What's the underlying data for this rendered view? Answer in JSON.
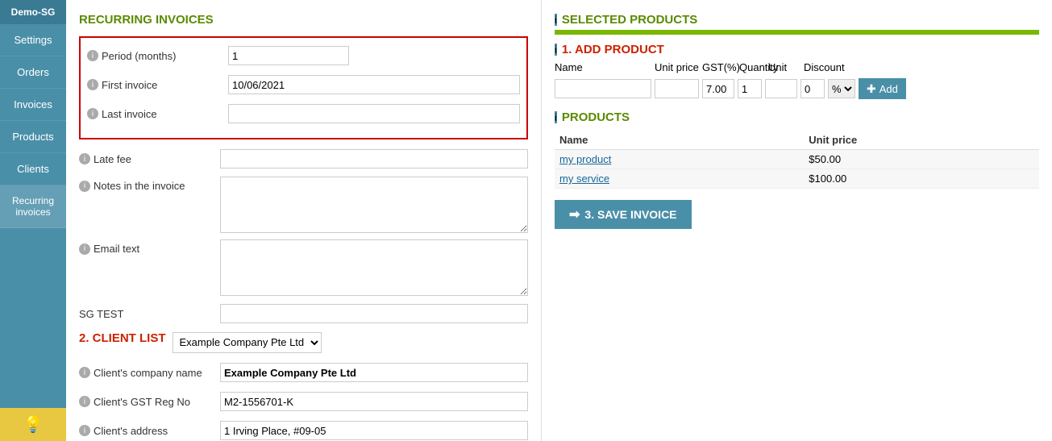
{
  "sidebar": {
    "demo_label": "Demo-SG",
    "items": [
      {
        "id": "settings",
        "label": "Settings"
      },
      {
        "id": "orders",
        "label": "Orders"
      },
      {
        "id": "invoices",
        "label": "Invoices"
      },
      {
        "id": "products",
        "label": "Products"
      },
      {
        "id": "clients",
        "label": "Clients"
      },
      {
        "id": "recurring",
        "label": "Recurring invoices",
        "active": true
      }
    ]
  },
  "left": {
    "recurring_title": "RECURRING INVOICES",
    "fields": {
      "period_label": "Period (months)",
      "period_value": "1",
      "first_invoice_label": "First invoice",
      "first_invoice_value": "10/06/2021",
      "last_invoice_label": "Last invoice",
      "last_invoice_value": "",
      "late_fee_label": "Late fee",
      "late_fee_value": "",
      "notes_label": "Notes in the invoice",
      "notes_value": "",
      "email_text_label": "Email text",
      "email_text_value": "",
      "sg_test_label": "SG TEST",
      "sg_test_value": ""
    },
    "client_list_title": "2. CLIENT LIST",
    "client_select_value": "Example Company Pte Ltd",
    "client_options": [
      "Example Company Pte Ltd"
    ],
    "client_company_label": "Client's company name",
    "client_company_value": "Example Company Pte Ltd",
    "client_gst_label": "Client's GST Reg No",
    "client_gst_value": "M2-1556701-K",
    "client_address_label": "Client's address",
    "client_address_value": "1 Irving Place, #09-05"
  },
  "right": {
    "selected_products_title": "SELECTED PRODUCTS",
    "add_product_title": "1. ADD PRODUCT",
    "add_product_headers": {
      "name": "Name",
      "unit_price": "Unit price",
      "gst": "GST(%)",
      "quantity": "Quantity",
      "unit": "Unit",
      "discount": "Discount"
    },
    "add_product_defaults": {
      "name": "",
      "unit_price": "",
      "gst": "7.00",
      "quantity": "1",
      "unit": "",
      "discount": "0",
      "discount_type": "%"
    },
    "add_button_label": "Add",
    "products_title": "PRODUCTS",
    "products_table_headers": {
      "name": "Name",
      "unit_price": "Unit price"
    },
    "products": [
      {
        "name": "my product",
        "unit_price": "$50.00"
      },
      {
        "name": "my service",
        "unit_price": "$100.00"
      }
    ],
    "save_invoice_label": "3. SAVE INVOICE"
  },
  "colors": {
    "green": "#5a8a00",
    "red": "#cc2200",
    "teal": "#4a8fa8"
  }
}
